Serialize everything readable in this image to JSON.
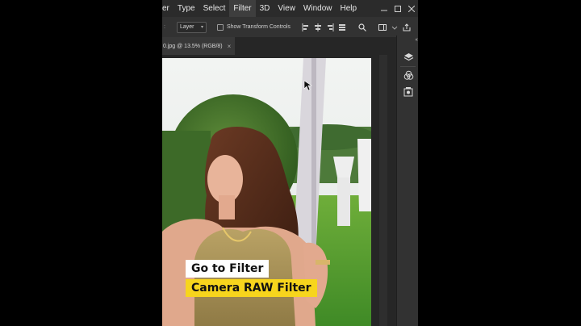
{
  "menubar": {
    "items": [
      "er",
      "Type",
      "Select",
      "Filter",
      "3D",
      "View",
      "Window",
      "Help"
    ],
    "active_item": "Filter"
  },
  "options": {
    "colon": ":",
    "layer_select": "Layer",
    "show_transform_controls": "Show Transform Controls"
  },
  "document_tab": {
    "title": "0.jpg @ 13.5% (RGB/8)",
    "close": "×"
  },
  "captions": {
    "line1": "Go to Filter",
    "line2": "Camera RAW Filter"
  },
  "colors": {
    "caption_highlight": "#f7d51d",
    "caption_white": "#ffffff",
    "ui_dark": "#323232"
  }
}
